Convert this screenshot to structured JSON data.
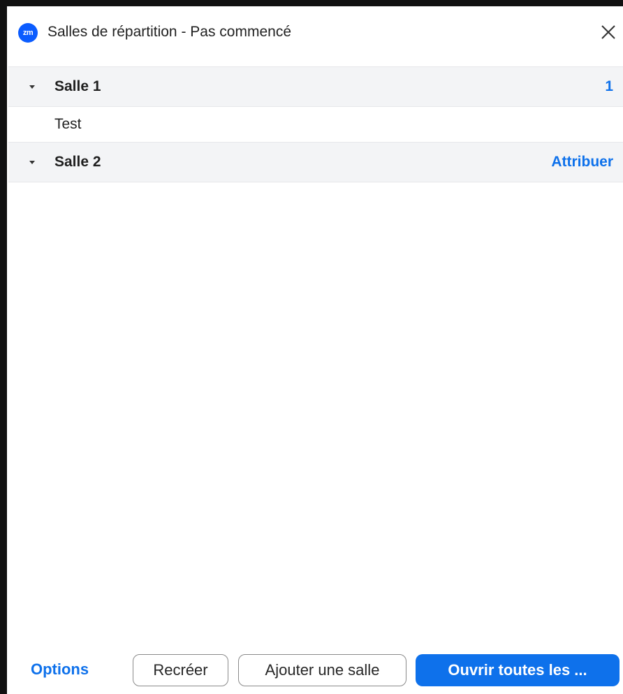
{
  "window": {
    "title": "Salles de répartition - Pas commencé",
    "logo_text": "zm",
    "icons": {
      "logo": "zoom-app-icon",
      "close": "close-icon",
      "expand": "caret-down-icon"
    }
  },
  "rooms": [
    {
      "name": "Salle 1",
      "action": "1",
      "participants": [
        "Test"
      ]
    },
    {
      "name": "Salle 2",
      "action": "Attribuer",
      "participants": []
    }
  ],
  "footer": {
    "options_label": "Options",
    "recreate_label": "Recréer",
    "add_room_label": "Ajouter une salle",
    "open_all_label": "Ouvrir toutes les ..."
  },
  "colors": {
    "accent": "#0e71eb",
    "row_background": "#f3f4f6",
    "logo": "#0b5cff"
  }
}
